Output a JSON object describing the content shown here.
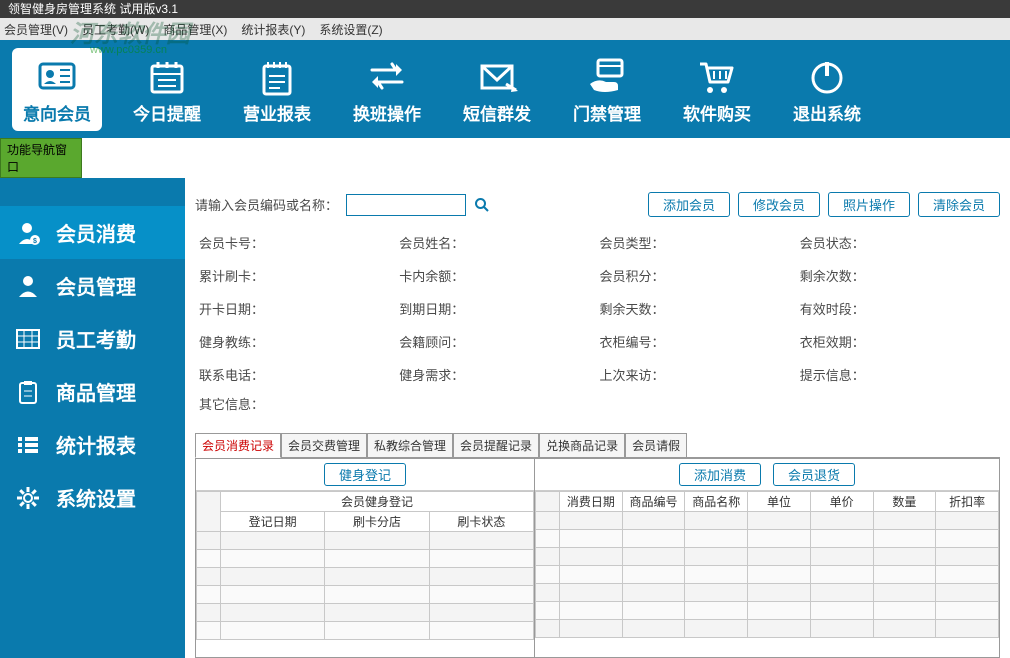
{
  "title": "领智健身房管理系统 试用版v3.1",
  "menu": {
    "member": "会员管理(V)",
    "staff": "员工考勤(W)",
    "product": "商品管理(X)",
    "report": "统计报表(Y)",
    "setting": "系统设置(Z)"
  },
  "watermark": {
    "big": "河东软件园",
    "small": "www.pc0359.cn"
  },
  "toolbar": [
    {
      "id": "intent",
      "label": "意向会员",
      "icon": "id-card",
      "active": true
    },
    {
      "id": "today",
      "label": "今日提醒",
      "icon": "calendar",
      "active": false
    },
    {
      "id": "sales",
      "label": "营业报表",
      "icon": "notepad",
      "active": false
    },
    {
      "id": "shift",
      "label": "换班操作",
      "icon": "swap",
      "active": false
    },
    {
      "id": "sms",
      "label": "短信群发",
      "icon": "envelope",
      "active": false
    },
    {
      "id": "access",
      "label": "门禁管理",
      "icon": "card-hand",
      "active": false
    },
    {
      "id": "buy",
      "label": "软件购买",
      "icon": "cart",
      "active": false
    },
    {
      "id": "exit",
      "label": "退出系统",
      "icon": "power",
      "active": false
    }
  ],
  "nav_handle": "功能导航窗口",
  "sidebar": [
    {
      "id": "consume",
      "label": "会员消费",
      "icon": "person-dollar",
      "active": true
    },
    {
      "id": "member",
      "label": "会员管理",
      "icon": "person",
      "active": false
    },
    {
      "id": "attend",
      "label": "员工考勤",
      "icon": "grid",
      "active": false
    },
    {
      "id": "goods",
      "label": "商品管理",
      "icon": "clipboard",
      "active": false
    },
    {
      "id": "stats",
      "label": "统计报表",
      "icon": "list",
      "active": false
    },
    {
      "id": "settings",
      "label": "系统设置",
      "icon": "gear",
      "active": false
    }
  ],
  "search": {
    "label": "请输入会员编码或名称：",
    "value": "",
    "buttons": {
      "add": "添加会员",
      "edit": "修改会员",
      "photo": "照片操作",
      "clear": "清除会员"
    }
  },
  "details": {
    "row1": [
      "会员卡号：",
      "会员姓名：",
      "会员类型：",
      "会员状态："
    ],
    "row2": [
      "累计刷卡：",
      "卡内余额：",
      "会员积分：",
      "剩余次数："
    ],
    "row3": [
      "开卡日期：",
      "到期日期：",
      "剩余天数：",
      "有效时段："
    ],
    "row4": [
      "健身教练：",
      "会籍顾问：",
      "衣柜编号：",
      "衣柜效期："
    ],
    "row5": [
      "联系电话：",
      "健身需求：",
      "上次来访：",
      "提示信息："
    ],
    "other": "其它信息："
  },
  "subtabs": [
    "会员消费记录",
    "会员交费管理",
    "私教综合管理",
    "会员提醒记录",
    "兑换商品记录",
    "会员请假"
  ],
  "left_pane": {
    "button": "健身登记",
    "group_header": "会员健身登记",
    "cols": [
      "登记日期",
      "刷卡分店",
      "刷卡状态"
    ]
  },
  "right_pane": {
    "buttons": {
      "add": "添加消费",
      "refund": "会员退货"
    },
    "cols": [
      "消费日期",
      "商品编号",
      "商品名称",
      "单位",
      "单价",
      "数量",
      "折扣率"
    ]
  }
}
